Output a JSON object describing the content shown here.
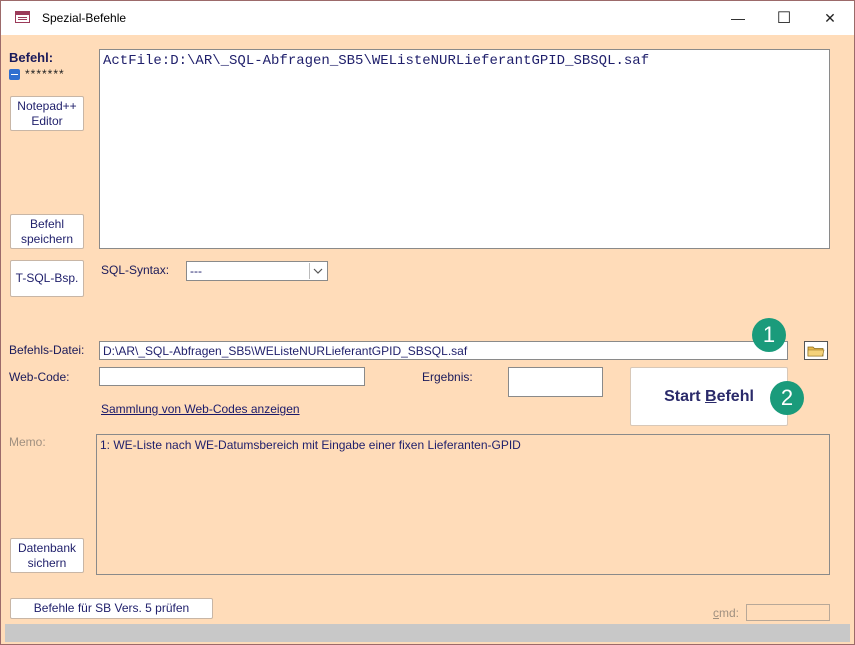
{
  "window": {
    "title": "Spezial-Befehle",
    "minimize_glyph": "—",
    "maximize_glyph": "☐",
    "close_glyph": "✕"
  },
  "left": {
    "befehl_label": "Befehl:",
    "mask": "*******",
    "notepad_btn": "Notepad++ Editor",
    "save_btn": "Befehl speichern",
    "tsql_btn": "T-SQL-Bsp.",
    "backup_btn": "Datenbank sichern",
    "check_btn": "Befehle für SB Vers. 5 prüfen"
  },
  "command": {
    "text": "ActFile:D:\\AR\\_SQL-Abfragen_SB5\\WEListeNURLieferantGPID_SBSQL.saf"
  },
  "syntax": {
    "label": "SQL-Syntax:",
    "value": "---"
  },
  "file": {
    "label": "Befehls-Datei:",
    "value": "D:\\AR\\_SQL-Abfragen_SB5\\WEListeNURLieferantGPID_SBSQL.saf"
  },
  "webcode": {
    "label": "Web-Code:",
    "value": "",
    "link": "Sammlung von Web-Codes anzeigen"
  },
  "ergebnis": {
    "label": "Ergebnis:",
    "value": ""
  },
  "start": {
    "label_pre": "Start ",
    "label_key": "B",
    "label_post": "efehl"
  },
  "memo": {
    "label": "Memo:",
    "text": "1: WE-Liste nach WE-Datumsbereich mit Eingabe einer fixen Lieferanten-GPID"
  },
  "cmd": {
    "label_key": "c",
    "label_rest": "md:",
    "value": ""
  },
  "badges": [
    "1",
    "2"
  ],
  "colors": {
    "background": "#ffdcb9",
    "accent_badge": "#1a9b7b",
    "text_navy": "#1f1f6b"
  }
}
